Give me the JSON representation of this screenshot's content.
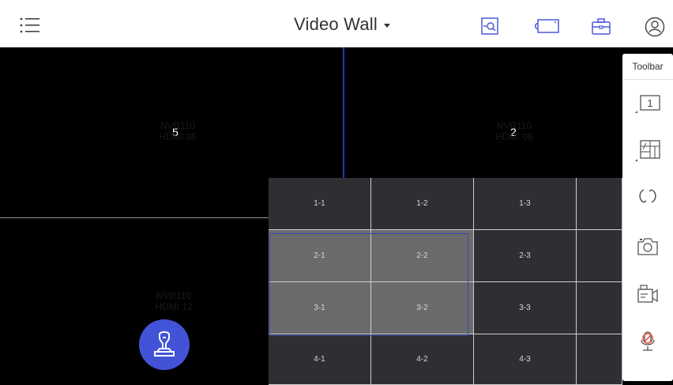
{
  "header": {
    "title": "Video Wall",
    "icons": [
      "menu-icon",
      "search-screen-icon",
      "screen-icon",
      "briefcase-icon",
      "user-icon"
    ]
  },
  "wall": {
    "tiles": [
      {
        "number": "5",
        "source_line1": "NVR110",
        "source_line2": "HDMI 05"
      },
      {
        "number": "2",
        "source_line1": "NVR110",
        "source_line2": "HDMI 06"
      },
      {
        "number": "",
        "source_line1": "NVR110",
        "source_line2": "HDMI 12"
      }
    ]
  },
  "grid": {
    "rows": [
      [
        "1-1",
        "1-2",
        "1-3",
        ""
      ],
      [
        "2-1",
        "2-2",
        "2-3",
        ""
      ],
      [
        "3-1",
        "3-2",
        "3-3",
        ""
      ],
      [
        "4-1",
        "4-2",
        "4-3",
        ""
      ]
    ],
    "selected": [
      "2-1",
      "2-2",
      "3-1",
      "3-2"
    ]
  },
  "toolbar": {
    "title": "Toolbar",
    "layout_label": "1",
    "buttons": [
      "single-layout-icon",
      "multi-layout-icon",
      "refresh-icon",
      "camera-icon",
      "record-icon",
      "mic-off-icon"
    ]
  },
  "colors": {
    "accent": "#4353d7",
    "selection_border": "#3b46b3",
    "wall_border": "#2e36a6"
  }
}
